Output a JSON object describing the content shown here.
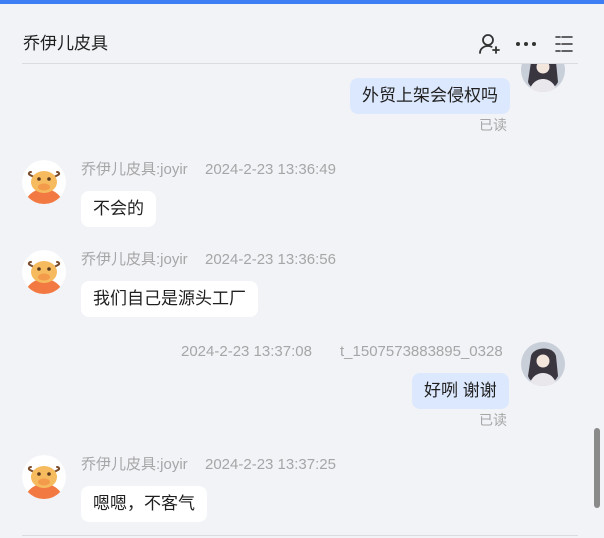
{
  "header": {
    "title": "乔伊儿皮具",
    "icons": [
      "user-add-icon",
      "more-icon",
      "list-menu-icon"
    ]
  },
  "messages": [
    {
      "direction": "out",
      "text": "外贸上架会侵权吗",
      "status": "已读"
    },
    {
      "direction": "in",
      "sender": "乔伊儿皮具:joyir",
      "time": "2024-2-23 13:36:49",
      "text": "不会的"
    },
    {
      "direction": "in",
      "sender": "乔伊儿皮具:joyir",
      "time": "2024-2-23 13:36:56",
      "text": "我们自己是源头工厂"
    },
    {
      "direction": "out",
      "sender": "t_1507573883895_0328",
      "time": "2024-2-23 13:37:08",
      "text": "好咧 谢谢",
      "status": "已读"
    },
    {
      "direction": "in",
      "sender": "乔伊儿皮具:joyir",
      "time": "2024-2-23 13:37:25",
      "text": "嗯嗯，不客气"
    }
  ],
  "colors": {
    "accent": "#3d7ef4",
    "out_bubble": "#dce8fd",
    "in_bubble": "#ffffff",
    "background": "#f2f3f7"
  }
}
